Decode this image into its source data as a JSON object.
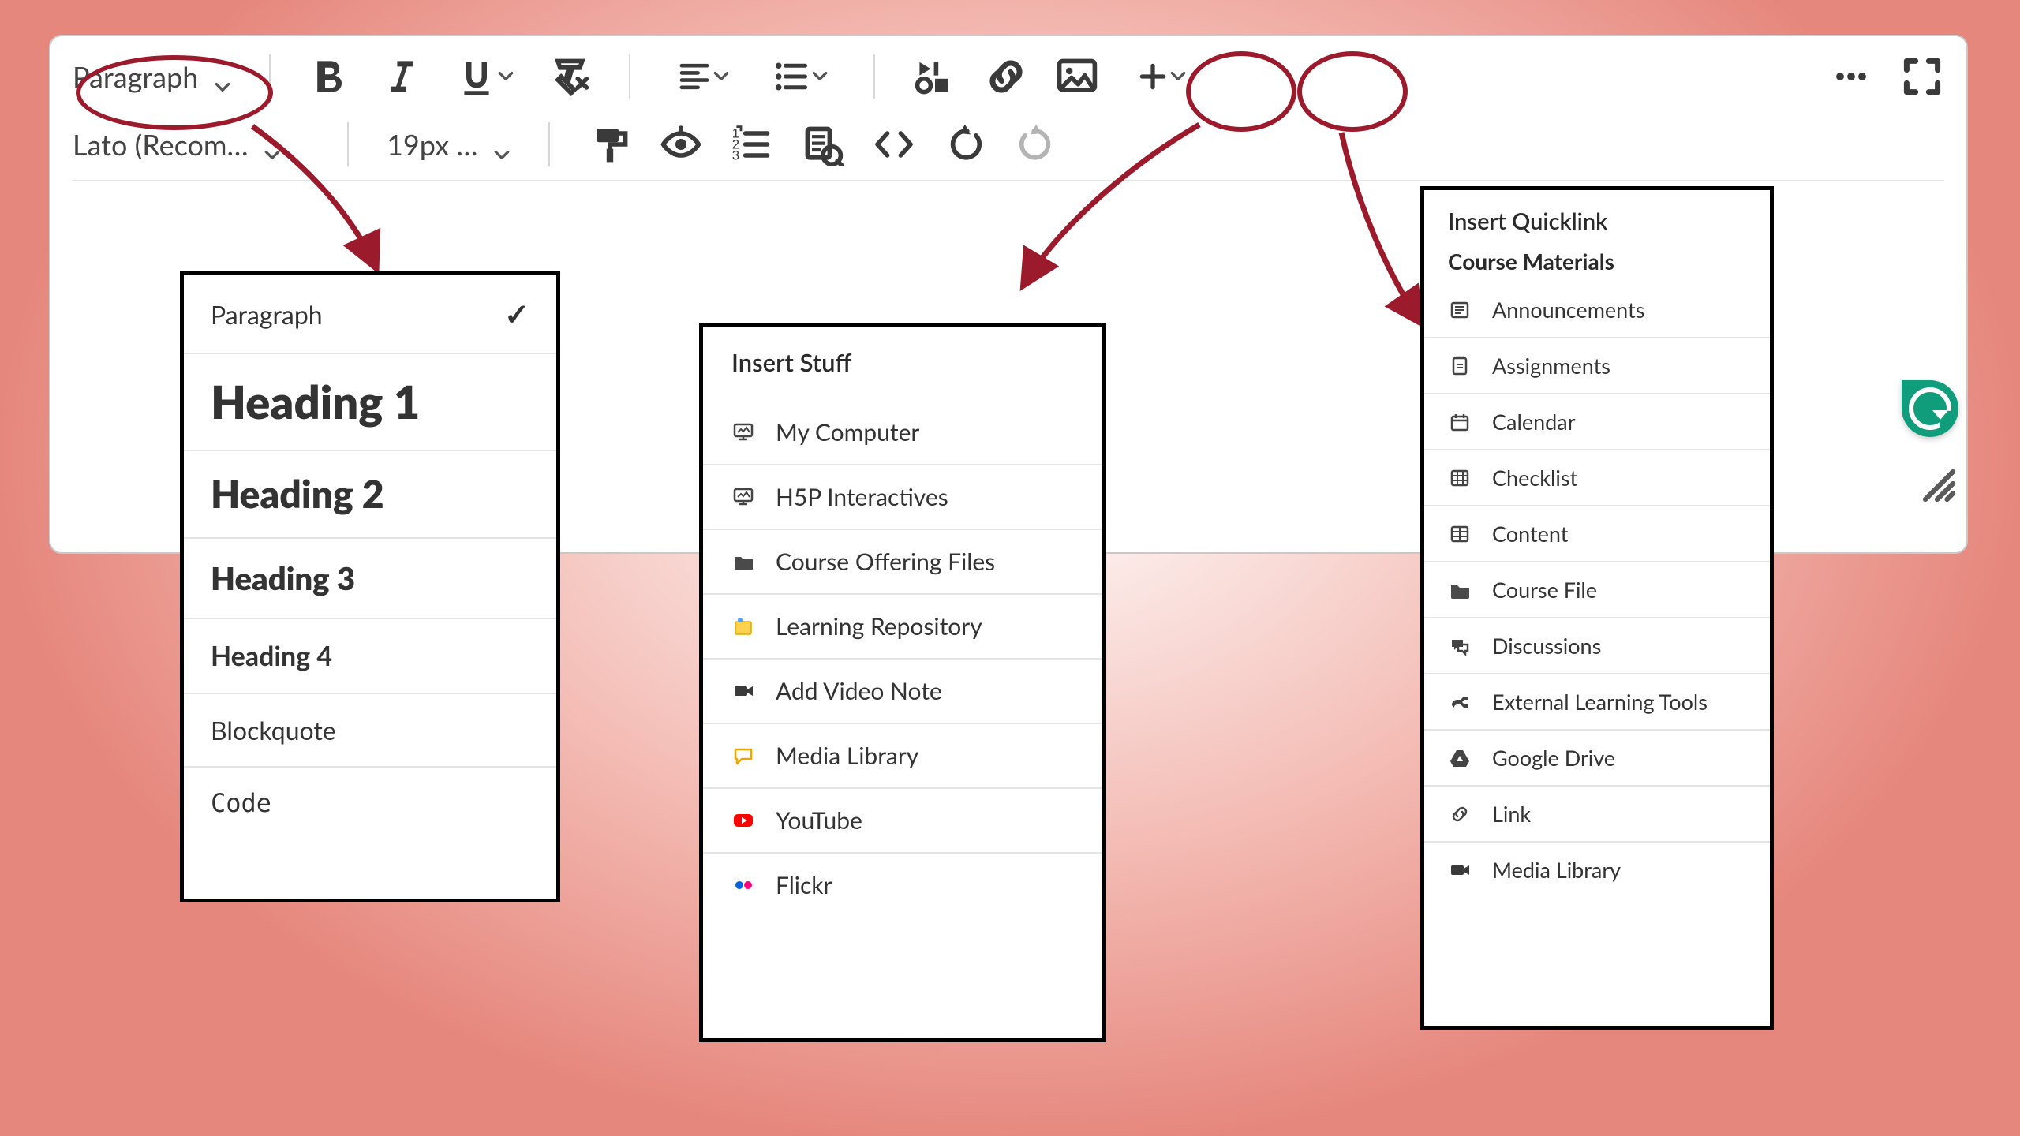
{
  "toolbar": {
    "block_format": "Paragraph",
    "font_family": "Lato (Recom…",
    "font_size": "19px …"
  },
  "format_menu": {
    "items": [
      {
        "label": "Paragraph",
        "cls": "p",
        "checked": true
      },
      {
        "label": "Heading 1",
        "cls": "h1",
        "checked": false
      },
      {
        "label": "Heading 2",
        "cls": "h2",
        "checked": false
      },
      {
        "label": "Heading 3",
        "cls": "h3",
        "checked": false
      },
      {
        "label": "Heading 4",
        "cls": "h4",
        "checked": false
      },
      {
        "label": "Blockquote",
        "cls": "bq",
        "checked": false
      },
      {
        "label": "Code",
        "cls": "code",
        "checked": false
      }
    ]
  },
  "insert_stuff": {
    "title": "Insert Stuff",
    "items": [
      {
        "label": "My Computer",
        "icon": "monitor"
      },
      {
        "label": "H5P Interactives",
        "icon": "monitor"
      },
      {
        "label": "Course Offering Files",
        "icon": "folder"
      },
      {
        "label": "Learning Repository",
        "icon": "lor"
      },
      {
        "label": "Add Video Note",
        "icon": "camera"
      },
      {
        "label": "Media Library",
        "icon": "speech"
      },
      {
        "label": "YouTube",
        "icon": "youtube"
      },
      {
        "label": "Flickr",
        "icon": "flickr"
      }
    ]
  },
  "quicklink": {
    "title": "Insert Quicklink",
    "section": "Course Materials",
    "items": [
      {
        "label": "Announcements",
        "icon": "news"
      },
      {
        "label": "Assignments",
        "icon": "assign"
      },
      {
        "label": "Calendar",
        "icon": "cal"
      },
      {
        "label": "Checklist",
        "icon": "check"
      },
      {
        "label": "Content",
        "icon": "content"
      },
      {
        "label": "Course File",
        "icon": "folder"
      },
      {
        "label": "Discussions",
        "icon": "disc"
      },
      {
        "label": "External Learning Tools",
        "icon": "plug"
      },
      {
        "label": "Google Drive",
        "icon": "gdrive"
      },
      {
        "label": "Link",
        "icon": "link"
      },
      {
        "label": "Media Library",
        "icon": "camera"
      }
    ]
  }
}
